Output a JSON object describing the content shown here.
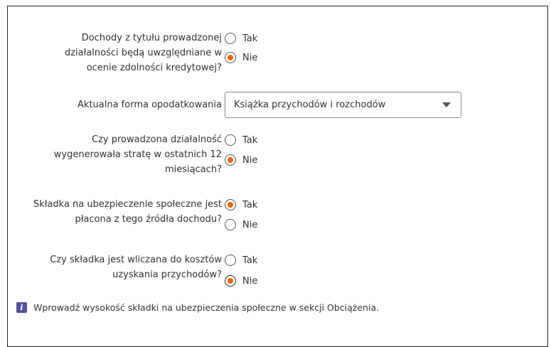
{
  "questions": [
    {
      "label_lines": [
        "Dochody z tytułu prowadzonej",
        "działalności będą uwzględniane w",
        "ocenie zdolności kredytowej?"
      ],
      "options": [
        {
          "label": "Tak",
          "selected": false
        },
        {
          "label": "Nie",
          "selected": true
        }
      ]
    },
    {
      "label_lines": [
        "Aktualna forma opodatkowania"
      ],
      "select_value": "Książka przychodów i rozchodów"
    },
    {
      "label_lines": [
        "Czy prowadzona działalność",
        "wygenerowała stratę w ostatnich 12",
        "miesiącach?"
      ],
      "options": [
        {
          "label": "Tak",
          "selected": false
        },
        {
          "label": "Nie",
          "selected": true
        }
      ]
    },
    {
      "label_lines": [
        "Składka na ubezpieczenie społeczne jest",
        "płacona z tego źródła dochodu?"
      ],
      "options": [
        {
          "label": "Tak",
          "selected": true
        },
        {
          "label": "Nie",
          "selected": false
        }
      ]
    },
    {
      "label_lines": [
        "Czy składka jest wliczana do kosztów",
        "uzyskania przychodów?"
      ],
      "options": [
        {
          "label": "Tak",
          "selected": false
        },
        {
          "label": "Nie",
          "selected": true
        }
      ]
    }
  ],
  "info": {
    "icon": "info-icon",
    "text": "Wprowadź wysokość składki na ubezpieczenia społeczne w sekcji Obciążenia."
  },
  "colors": {
    "accent": "#ff6200",
    "info_icon_bg": "#525199",
    "text": "#333333"
  }
}
